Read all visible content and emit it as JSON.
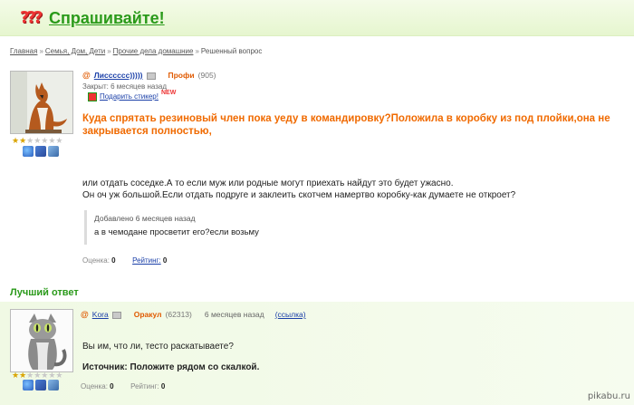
{
  "header": {
    "logo_icon": "question-marks-icon",
    "title": "Спрашивайте!"
  },
  "breadcrumb": [
    "Главная",
    "Семья, Дом, Дети",
    "Прочие дела домашние",
    "Решенный вопрос"
  ],
  "question": {
    "avatar": "fox-avatar",
    "stars": {
      "filled": 2,
      "total": 7
    },
    "user": {
      "name": "Лисссссс)))))",
      "rank": "Профи",
      "points": "(905)"
    },
    "closed": "Закрыт: 6 месяцев назад",
    "sticker": {
      "label": "Подарить стикер!",
      "badge": "NEW"
    },
    "title": "Куда спрятать резиновый член пока уеду в командировку?Положила в коробку из под плойки,она не закрывается полностью,",
    "body": [
      "или отдать соседке.А то если муж или родные могут приехать найдут это будет ужасно.",
      "Он оч уж большой.Если отдать подруге и заклеить скотчем намертво коробку-как думаете не откроет?"
    ],
    "addendum": {
      "when": "Добавлено 6 месяцев назад",
      "text": "а в чемодане просветит его?если возьму"
    },
    "meta": {
      "score_label": "Оценка:",
      "score": "0",
      "rating_label": "Рейтинг:",
      "rating": "0"
    }
  },
  "best_answer": {
    "heading": "Лучший ответ",
    "avatar": "cat-avatar",
    "stars": {
      "filled": 2,
      "total": 7
    },
    "user": {
      "name": "Kora",
      "rank": "Оракул",
      "points": "(62313)"
    },
    "time": "6 месяцев назад",
    "link": "(ссылка)",
    "text": "Вы им, что ли, тесто раскатываете?",
    "source": "Источник: Положите рядом со скалкой.",
    "meta": {
      "score_label": "Оценка:",
      "score": "0",
      "rating_label": "Рейтинг:",
      "rating": "0"
    }
  },
  "watermark": "pikabu.ru",
  "colors": {
    "accent_green": "#2a9a1a",
    "accent_orange": "#f06a00",
    "link_blue": "#1a3fa8"
  }
}
